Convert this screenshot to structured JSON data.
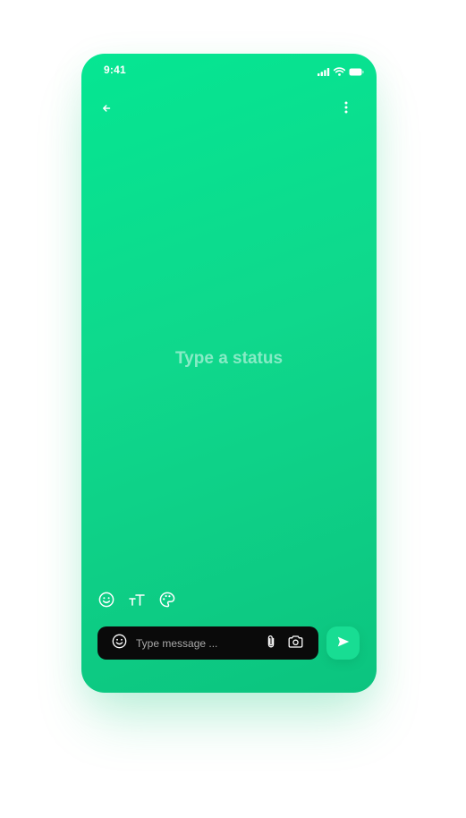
{
  "status_bar": {
    "time": "9:41"
  },
  "icons": {
    "back": "arrow-left-icon",
    "more": "more-vertical-icon",
    "emoji": "smiley-icon",
    "text_size": "text-size-icon",
    "palette": "palette-icon",
    "attach": "paperclip-icon",
    "camera": "camera-icon",
    "send": "send-icon"
  },
  "canvas": {
    "placeholder": "Type a status"
  },
  "composer": {
    "placeholder": "Type message ...",
    "value": ""
  },
  "colors": {
    "background_start": "#05e692",
    "background_end": "#0cc47f",
    "composer_bg": "#0a0a0a",
    "send_bg": "#18dd93",
    "text": "#ffffff"
  }
}
